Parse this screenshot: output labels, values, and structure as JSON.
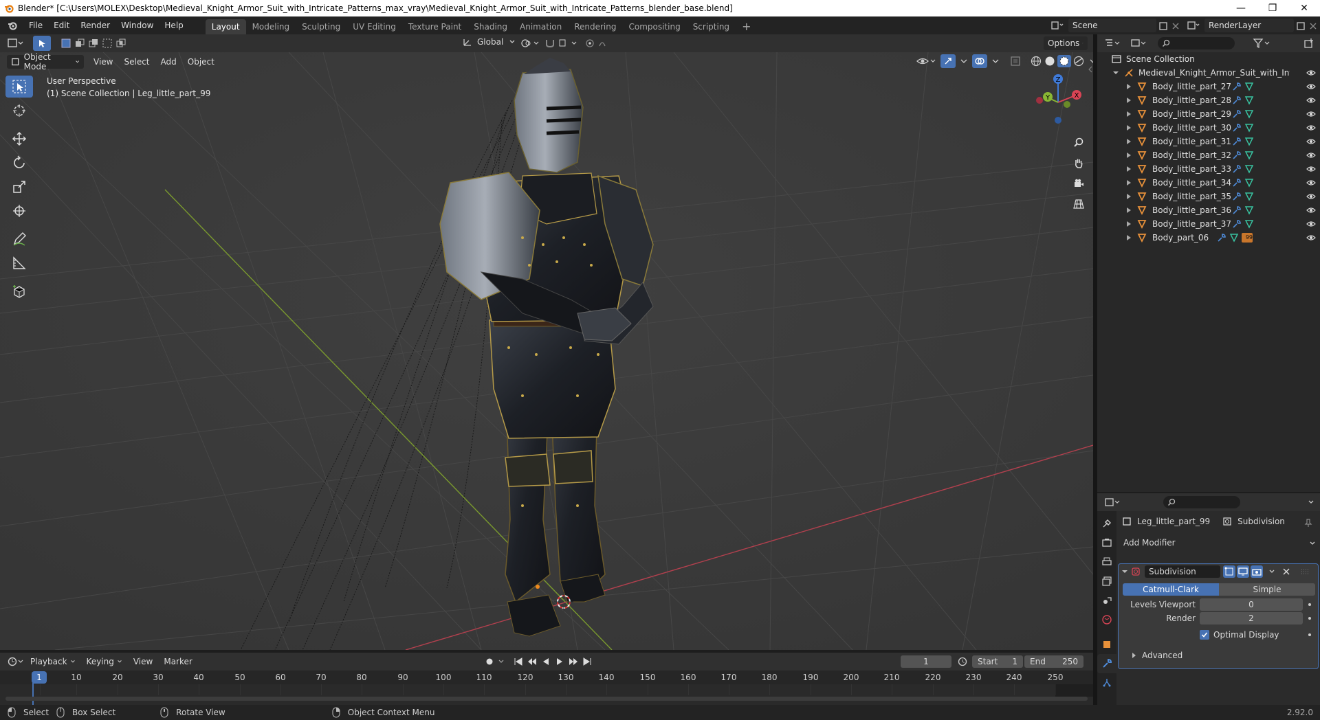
{
  "titlebar": {
    "text": "Blender* [C:\\Users\\MOLEX\\Desktop\\Medieval_Knight_Armor_Suit_with_Intricate_Patterns_max_vray\\Medieval_Knight_Armor_Suit_with_Intricate_Patterns_blender_base.blend]",
    "minimize": "—",
    "maximize": "❐",
    "close": "✕"
  },
  "menu": [
    "File",
    "Edit",
    "Render",
    "Window",
    "Help"
  ],
  "workspaces": [
    "Layout",
    "Modeling",
    "Sculpting",
    "UV Editing",
    "Texture Paint",
    "Shading",
    "Animation",
    "Rendering",
    "Compositing",
    "Scripting"
  ],
  "workspace_add": "+",
  "scene": "Scene",
  "render_layer": "RenderLayer",
  "viewport_header": {
    "orientation": "Global",
    "options": "Options",
    "mode": "Object Mode",
    "menus": [
      "View",
      "Select",
      "Add",
      "Object"
    ]
  },
  "viewport_info": {
    "line1": "User Perspective",
    "line2": "(1) Scene Collection | Leg_little_part_99"
  },
  "gizmo": {
    "z": "Z",
    "y": "Y",
    "x": "X"
  },
  "outliner": {
    "root": "Scene Collection",
    "collection": "Medieval_Knight_Armor_Suit_with_Intricate_",
    "items": [
      "Body_little_part_27",
      "Body_little_part_28",
      "Body_little_part_29",
      "Body_little_part_30",
      "Body_little_part_31",
      "Body_little_part_32",
      "Body_little_part_33",
      "Body_little_part_34",
      "Body_little_part_35",
      "Body_little_part_36",
      "Body_little_part_37",
      "Body_part_06"
    ],
    "last_badge": "99"
  },
  "properties": {
    "object": "Leg_little_part_99",
    "modifier_crumb": "Subdivision",
    "add_modifier": "Add Modifier",
    "modifier_name": "Subdivision",
    "mode_a": "Catmull-Clark",
    "mode_b": "Simple",
    "levels_viewport_label": "Levels Viewport",
    "levels_viewport": "0",
    "render_label": "Render",
    "render": "2",
    "optimal_display": "Optimal Display",
    "advanced": "Advanced"
  },
  "timeline": {
    "menus": [
      "Playback",
      "Keying",
      "View",
      "Marker"
    ],
    "current_frame": "1",
    "start_label": "Start",
    "start": "1",
    "end_label": "End",
    "end": "250",
    "ticks": [
      "1",
      "10",
      "20",
      "30",
      "40",
      "50",
      "60",
      "70",
      "80",
      "90",
      "100",
      "110",
      "120",
      "130",
      "140",
      "150",
      "160",
      "170",
      "180",
      "190",
      "200",
      "210",
      "220",
      "230",
      "240",
      "250"
    ]
  },
  "status": {
    "select": "Select",
    "box_select": "Box Select",
    "rotate_view": "Rotate View",
    "context_menu": "Object Context Menu",
    "version": "2.92.0"
  },
  "colors": {
    "accent_blue": "#4772b3",
    "object_orange": "#e8913a",
    "mesh_green": "#39c2a0",
    "axis_red": "#d94455",
    "axis_green": "#8ab734",
    "axis_blue": "#3f7ad8"
  }
}
